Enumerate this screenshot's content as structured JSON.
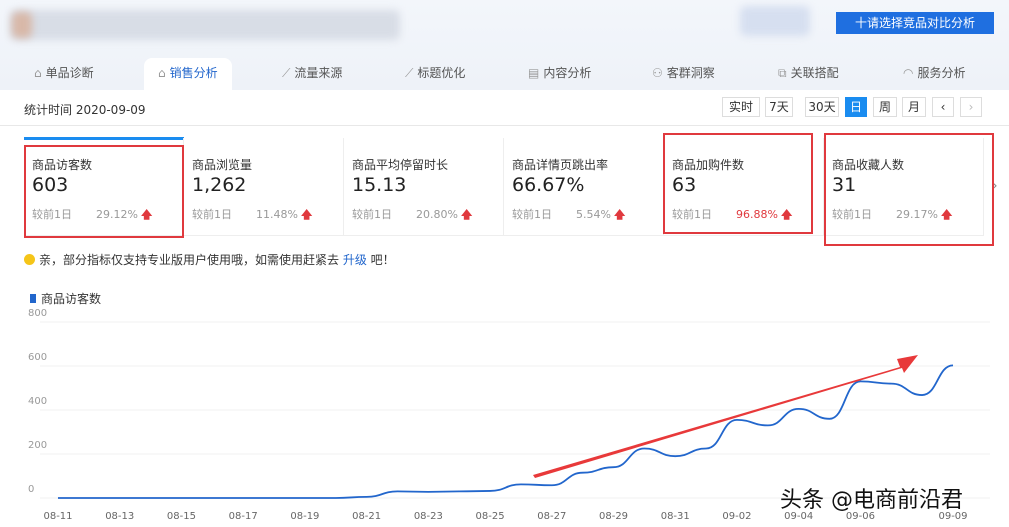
{
  "header": {
    "compare_button": "十请选择竞品对比分析"
  },
  "tabs": [
    {
      "label": "单品诊断",
      "icon": "bag-icon"
    },
    {
      "label": "销售分析",
      "icon": "bag-icon",
      "active": true
    },
    {
      "label": "流量来源",
      "icon": "line-chart-icon"
    },
    {
      "label": "标题优化",
      "icon": "line-chart-icon"
    },
    {
      "label": "内容分析",
      "icon": "document-icon"
    },
    {
      "label": "客群洞察",
      "icon": "users-icon"
    },
    {
      "label": "关联搭配",
      "icon": "link-icon"
    },
    {
      "label": "服务分析",
      "icon": "headset-icon"
    }
  ],
  "date_row": {
    "stat_time": "统计时间 2020-09-09",
    "periods": [
      "实时",
      "7天",
      "30天",
      "日",
      "周",
      "月"
    ],
    "active_period": "日"
  },
  "metrics": [
    {
      "label": "商品访客数",
      "value": "603",
      "compare": "较前1日",
      "pct": "29.12%"
    },
    {
      "label": "商品浏览量",
      "value": "1,262",
      "compare": "较前1日",
      "pct": "11.48%"
    },
    {
      "label": "商品平均停留时长",
      "value": "15.13",
      "compare": "较前1日",
      "pct": "20.80%"
    },
    {
      "label": "商品详情页跳出率",
      "value": "66.67%",
      "compare": "较前1日",
      "pct": "5.54%"
    },
    {
      "label": "商品加购件数",
      "value": "63",
      "compare": "较前1日",
      "pct": "96.88%"
    },
    {
      "label": "商品收藏人数",
      "value": "31",
      "compare": "较前1日",
      "pct": "29.17%"
    }
  ],
  "notice": {
    "text": "亲，部分指标仅支持专业版用户使用哦，如需使用赶紧去 ",
    "link": "升级",
    "suffix": " 吧！"
  },
  "colors": {
    "accent": "#1f6fe0",
    "line": "#2266cc",
    "up": "#e0393e"
  },
  "watermark": "头条 @电商前沿君",
  "chart_data": {
    "type": "line",
    "title": "商品访客数",
    "legend": "top-left",
    "ylim": [
      0,
      800
    ],
    "yticks": [
      0,
      200,
      400,
      600,
      800
    ],
    "x": [
      "08-11",
      "08-12",
      "08-13",
      "08-14",
      "08-15",
      "08-16",
      "08-17",
      "08-18",
      "08-19",
      "08-20",
      "08-21",
      "08-22",
      "08-23",
      "08-24",
      "08-25",
      "08-26",
      "08-27",
      "08-28",
      "08-29",
      "08-30",
      "08-31",
      "09-01",
      "09-02",
      "09-03",
      "09-04",
      "09-05",
      "09-06",
      "09-07",
      "09-08",
      "09-09"
    ],
    "xtick_labels": [
      "08-11",
      "08-13",
      "08-15",
      "08-17",
      "08-19",
      "08-21",
      "08-23",
      "08-25",
      "08-27",
      "08-29",
      "08-31",
      "09-02",
      "09-04",
      "09-06",
      "09-09"
    ],
    "series": [
      {
        "name": "商品访客数",
        "values": [
          0,
          0,
          0,
          0,
          0,
          0,
          0,
          0,
          0,
          0,
          5,
          30,
          28,
          30,
          32,
          62,
          58,
          115,
          140,
          225,
          190,
          225,
          355,
          330,
          405,
          360,
          530,
          520,
          468,
          603
        ]
      }
    ]
  }
}
